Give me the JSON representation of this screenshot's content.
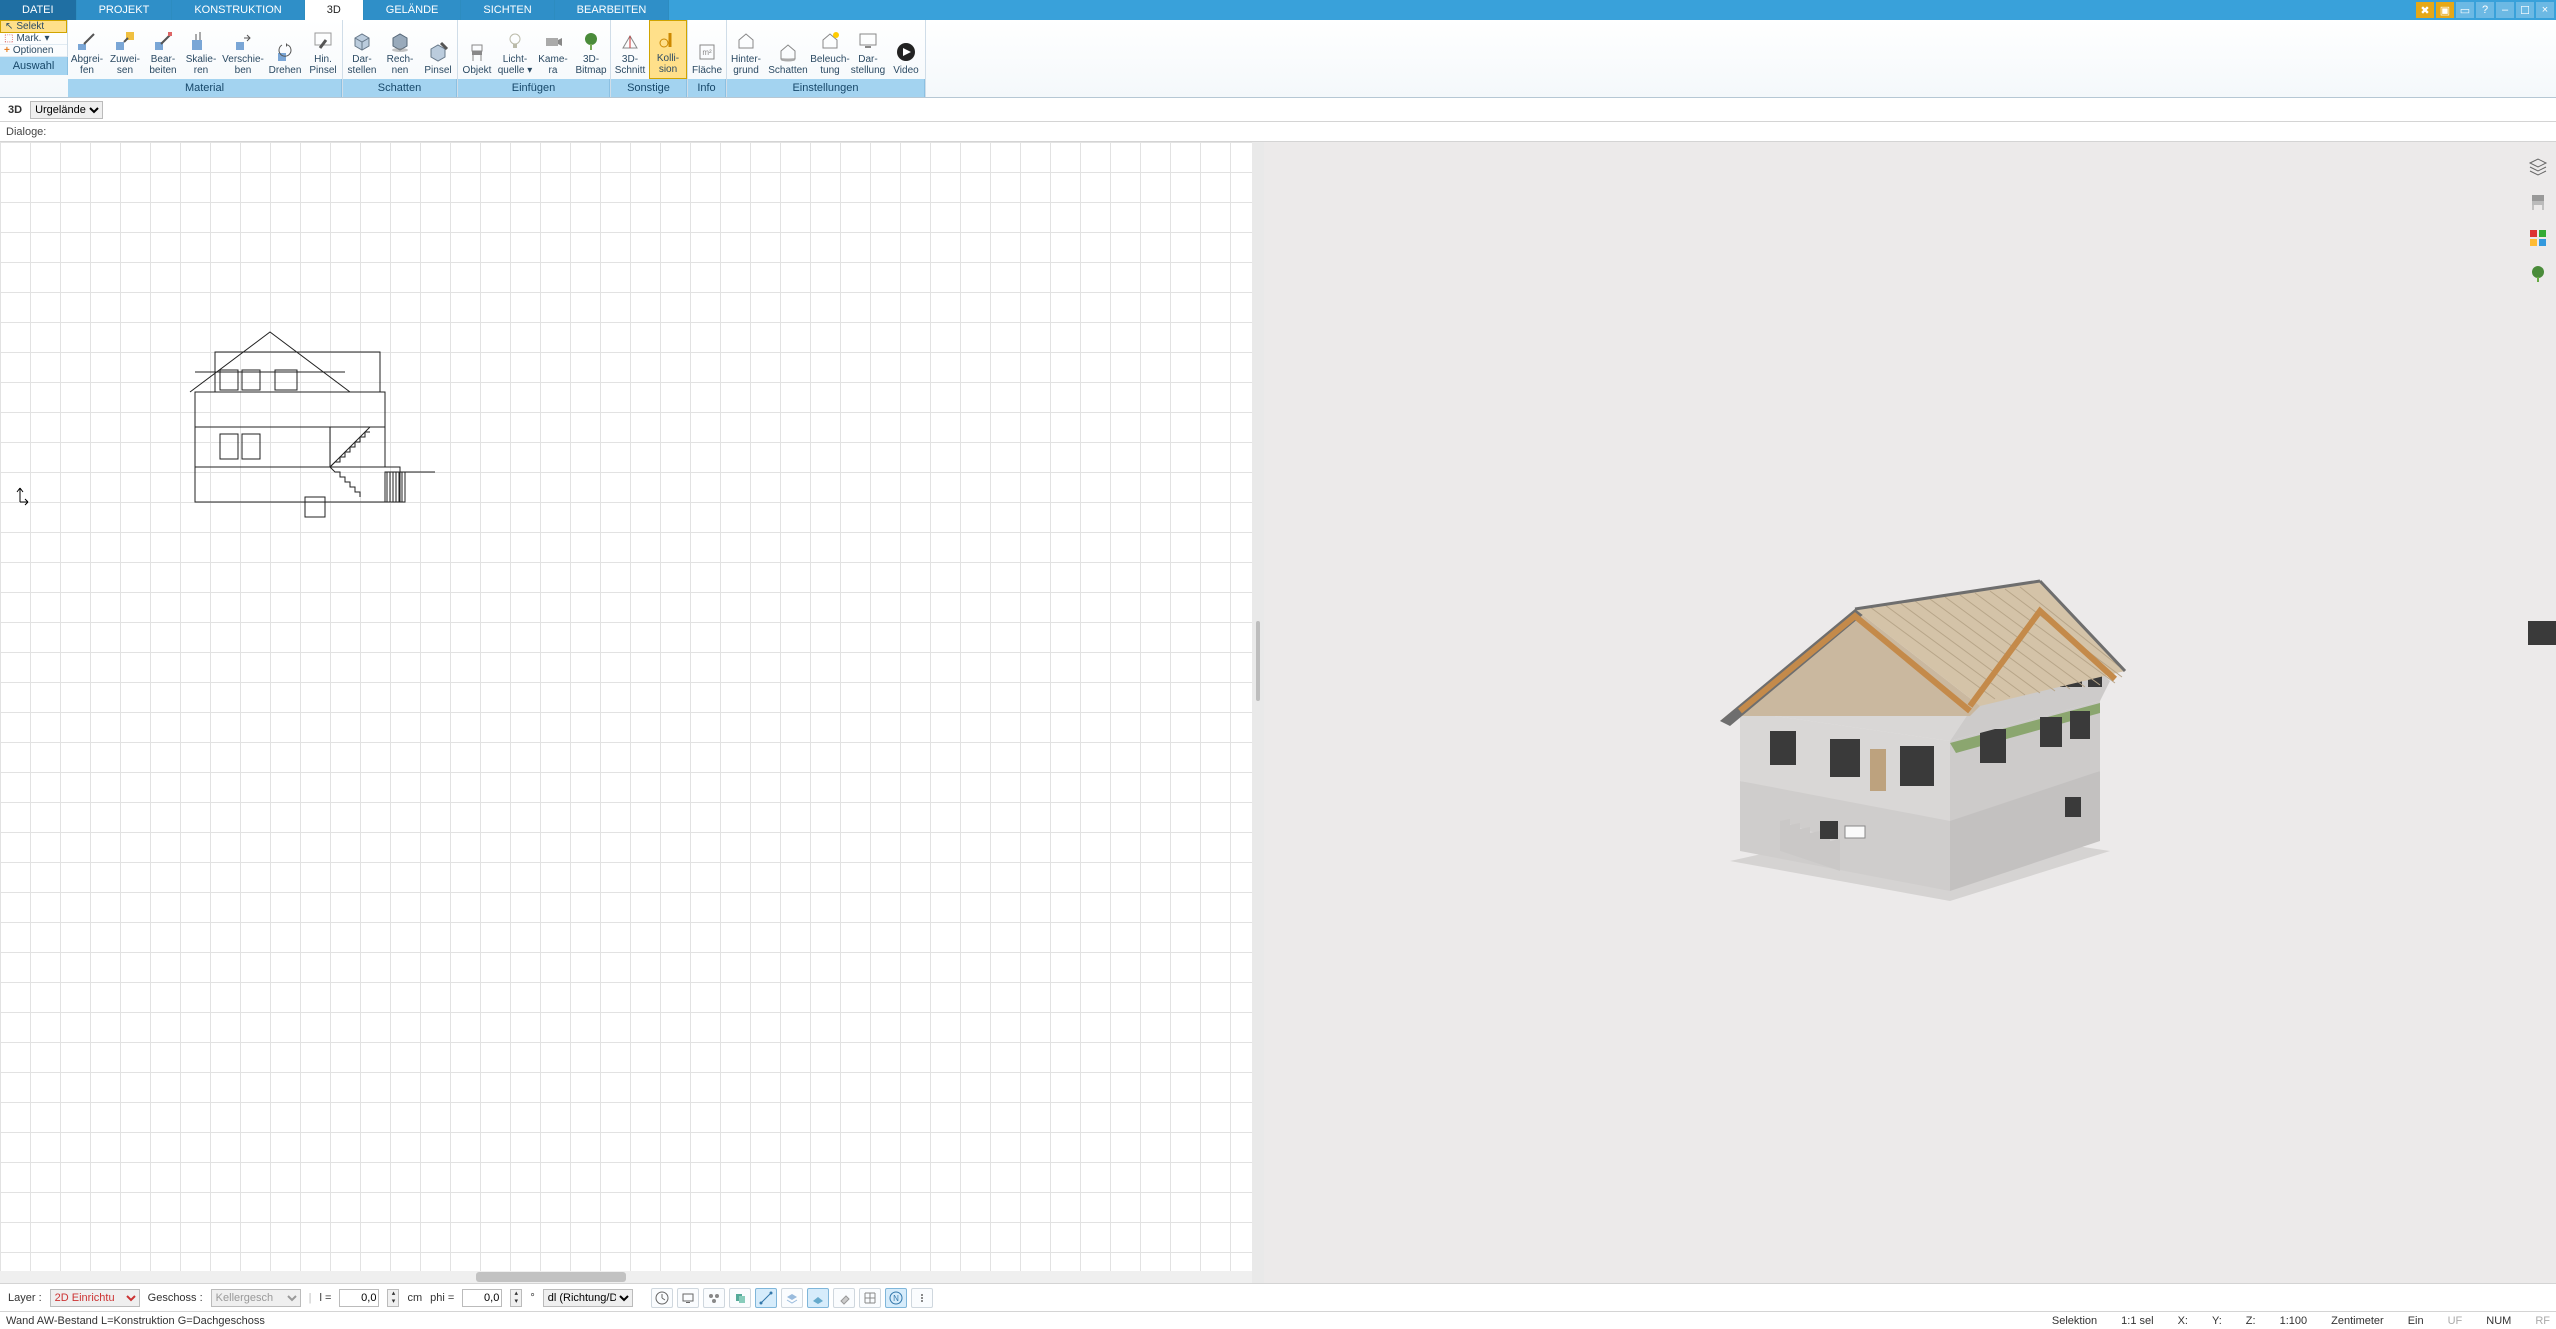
{
  "tabs": {
    "datei": "DATEI",
    "projekt": "PROJEKT",
    "konstruktion": "KONSTRUKTION",
    "d3": "3D",
    "gelaende": "GELÄNDE",
    "sichten": "SICHTEN",
    "bearbeiten": "BEARBEITEN"
  },
  "auswahl": {
    "selekt": "Selekt",
    "mark": "Mark.",
    "optionen": "Optionen",
    "footer": "Auswahl"
  },
  "groups": {
    "material": "Material",
    "schatten": "Schatten",
    "einfuegen": "Einfügen",
    "sonstige": "Sonstige",
    "info": "Info",
    "einstellungen": "Einstellungen"
  },
  "rb": {
    "abgreifen": "Abgrei-\nfen",
    "zuweisen": "Zuwei-\nsen",
    "bearbeiten": "Bear-\nbeiten",
    "skalieren": "Skalie-\nren",
    "verschieben": "Verschie-\nben",
    "drehen": "Drehen",
    "hinpinsel": "Hin.\nPinsel",
    "darstellen": "Dar-\nstellen",
    "rechnen": "Rech-\nnen",
    "pinsel": "Pinsel",
    "objekt": "Objekt",
    "lichtquelle": "Licht-\nquelle ▾",
    "kamera": "Kame-\nra",
    "bitmap3d": "3D-\nBitmap",
    "schnitt3d": "3D-\nSchnitt",
    "kollision": "Kolli-\nsion",
    "flaeche": "Fläche",
    "hintergrund": "Hinter-\ngrund",
    "schattenS": "Schatten",
    "beleuchtung": "Beleuch-\ntung",
    "darstellung": "Dar-\nstellung",
    "video": "Video"
  },
  "subbar": {
    "mode": "3D",
    "gelaende_sel": "Urgelände"
  },
  "dialoge": "Dialoge:",
  "bottom": {
    "layer": "Layer :",
    "layer_val": "2D Einrichtu",
    "geschoss": "Geschoss :",
    "geschoss_val": "Kellergesch",
    "l": "l =",
    "l_val": "0,0",
    "cm": "cm",
    "phi": "phi =",
    "phi_val": "0,0",
    "deg": "°",
    "dl": "dl (Richtung/Di"
  },
  "status": {
    "left": "Wand AW-Bestand L=Konstruktion G=Dachgeschoss",
    "sel": "Selektion",
    "ratio": "1:1 sel",
    "x": "X:",
    "y": "Y:",
    "z": "Z:",
    "scale": "1:100",
    "unit": "Zentimeter",
    "ein": "Ein",
    "uf": "UF",
    "num": "NUM",
    "rf": "RF"
  }
}
